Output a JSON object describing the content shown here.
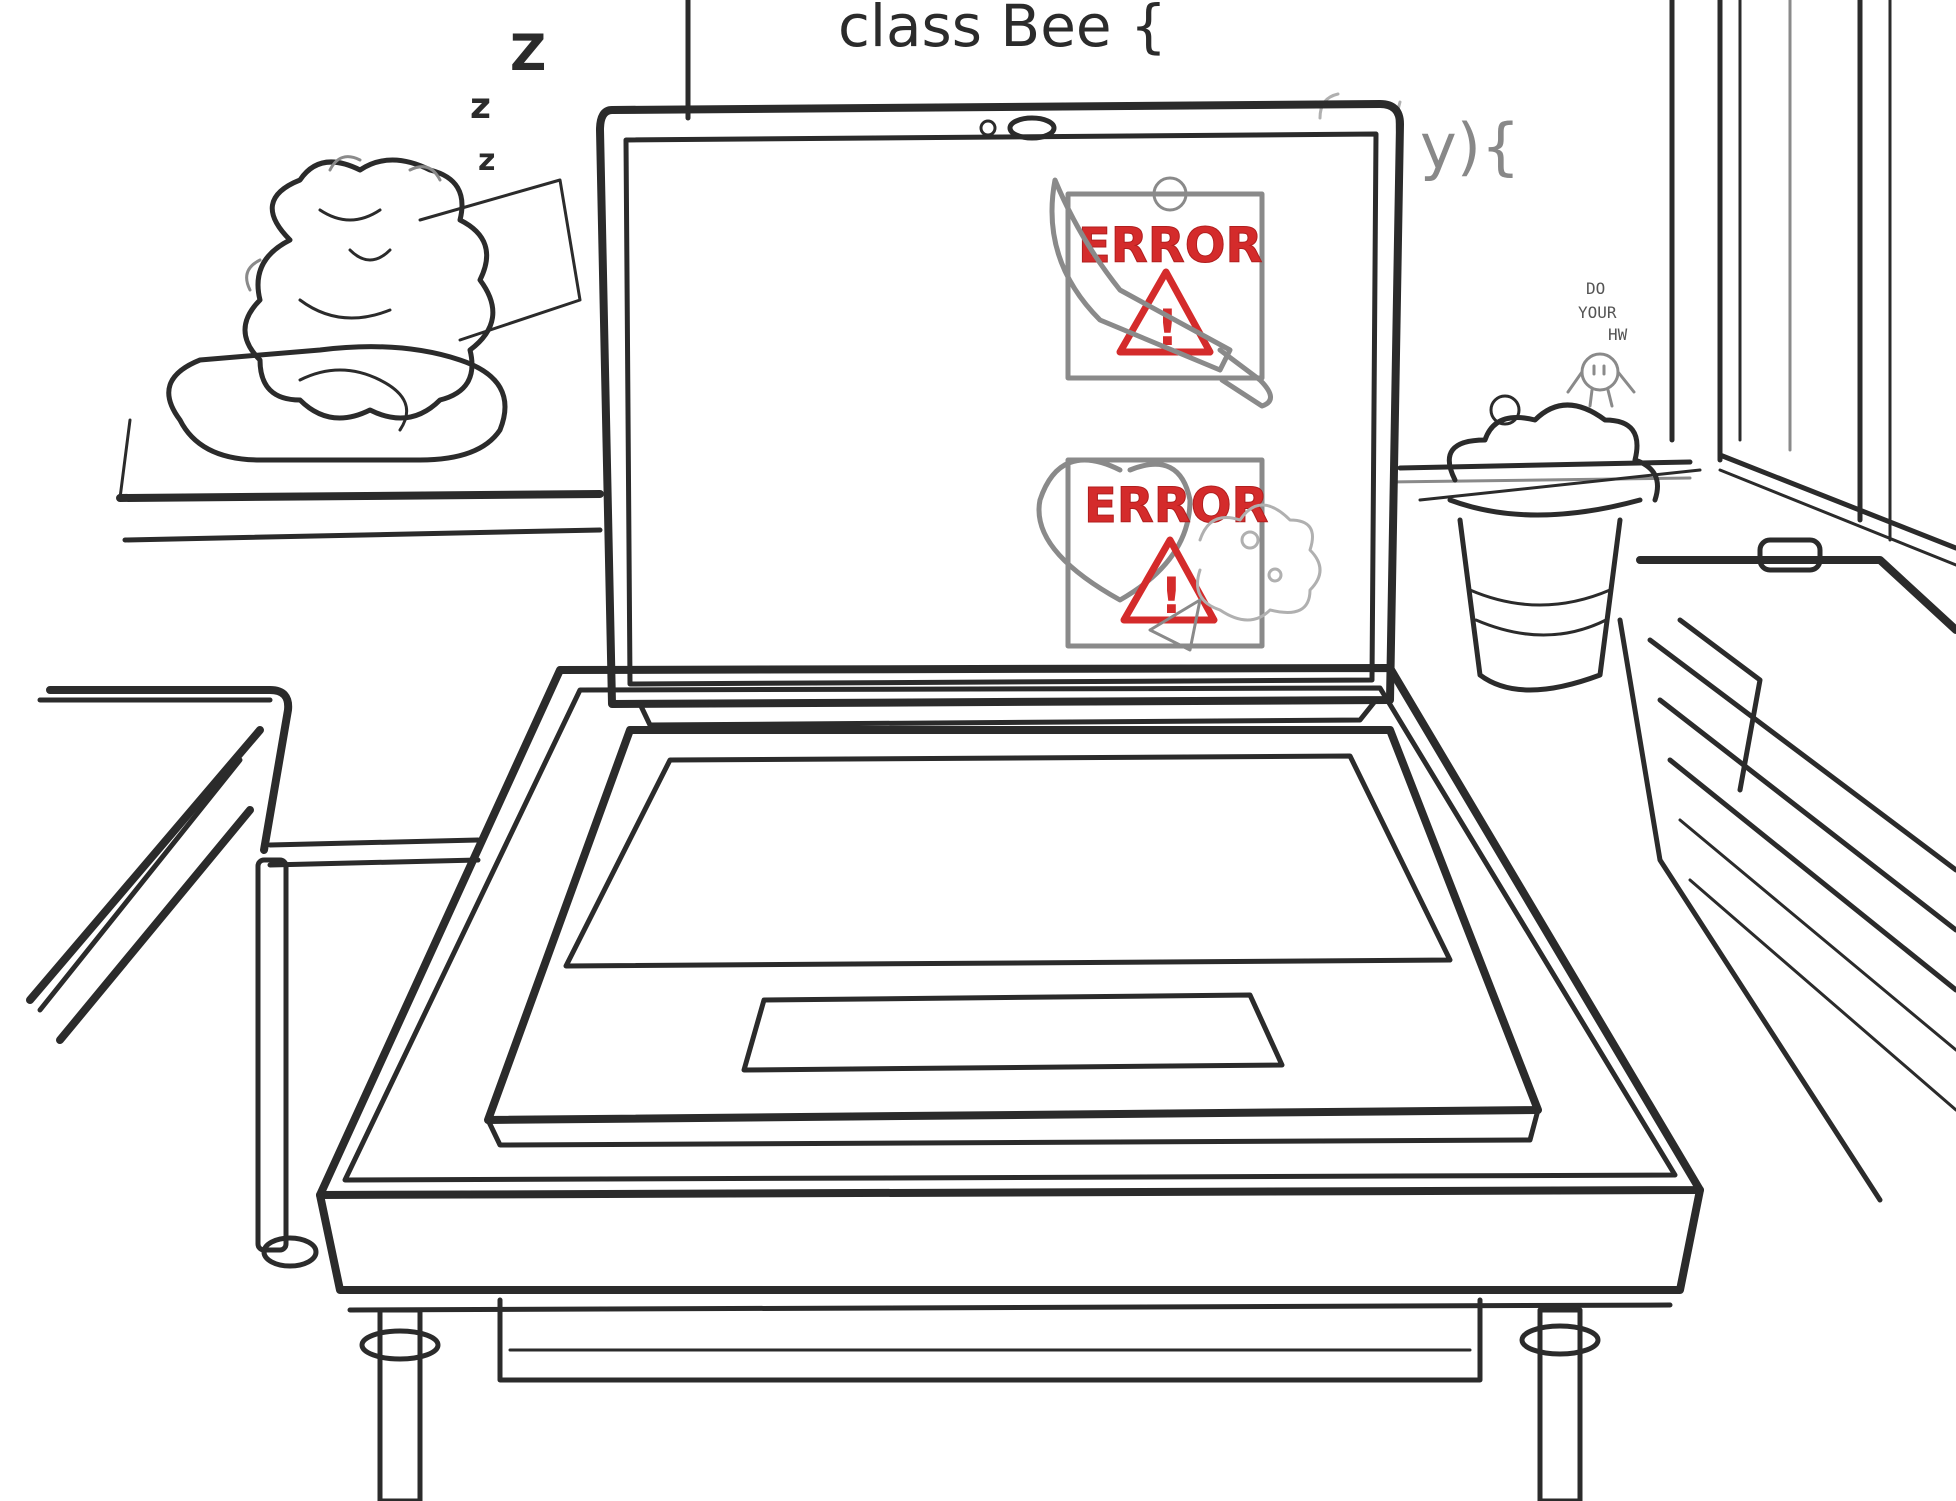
{
  "whiteboard": {
    "code_line": "class Bee {",
    "code_fragment": "y){",
    "note_line1": "DO",
    "note_line2": "YOUR",
    "note_line3": "HW"
  },
  "sleeper": {
    "zzz": [
      "z",
      "z",
      "Z"
    ]
  },
  "laptop_screen": {
    "error_windows": [
      {
        "label": "ERROR",
        "warning_glyph": "!",
        "attachment": "knife-icon"
      },
      {
        "label": "ERROR",
        "warning_glyph": "!",
        "attachment": "heart-icon"
      }
    ]
  },
  "colors": {
    "error_red": "#d42b2b",
    "ink": "#2b2b2b"
  }
}
